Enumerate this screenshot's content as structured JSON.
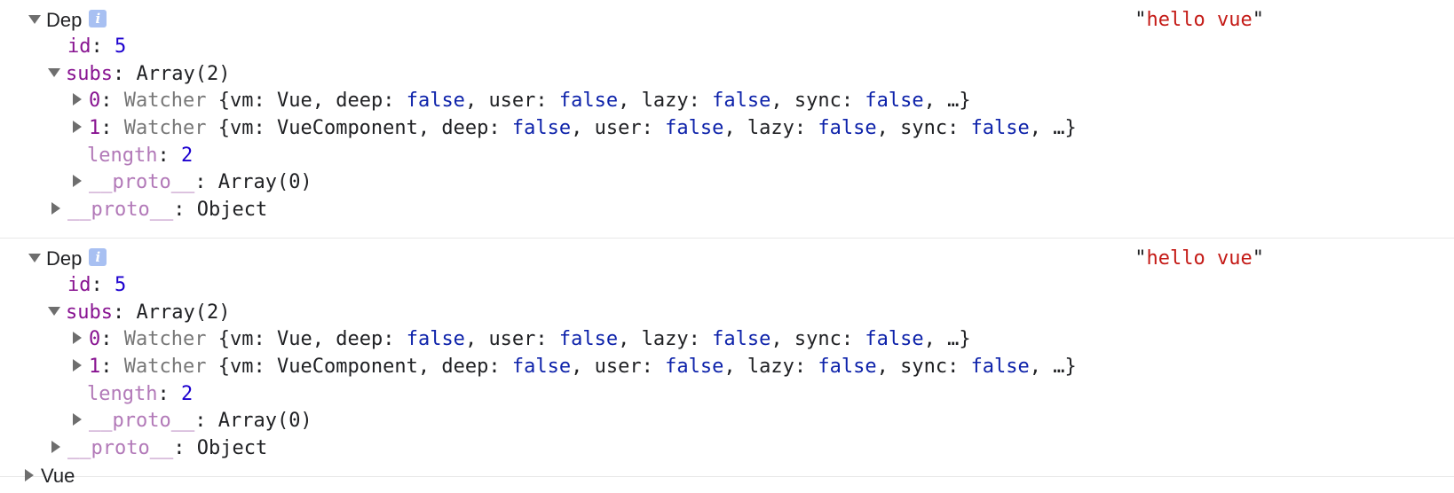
{
  "entries": [
    {
      "title": "Dep",
      "info_icon": "i",
      "message": "hello vue",
      "id_key": "id",
      "id_value": "5",
      "subs_key": "subs",
      "subs_value": "Array(2)",
      "items": [
        {
          "index": "0",
          "class": "Watcher",
          "preview": [
            {
              "k": "vm",
              "v": "Vue",
              "t": "plain"
            },
            {
              "k": "deep",
              "v": "false",
              "t": "kw"
            },
            {
              "k": "user",
              "v": "false",
              "t": "kw"
            },
            {
              "k": "lazy",
              "v": "false",
              "t": "kw"
            },
            {
              "k": "sync",
              "v": "false",
              "t": "kw"
            }
          ]
        },
        {
          "index": "1",
          "class": "Watcher",
          "preview": [
            {
              "k": "vm",
              "v": "VueComponent",
              "t": "plain"
            },
            {
              "k": "deep",
              "v": "false",
              "t": "kw"
            },
            {
              "k": "user",
              "v": "false",
              "t": "kw"
            },
            {
              "k": "lazy",
              "v": "false",
              "t": "kw"
            },
            {
              "k": "sync",
              "v": "false",
              "t": "kw"
            }
          ]
        }
      ],
      "length_key": "length",
      "length_value": "2",
      "array_proto_key": "__proto__",
      "array_proto_value": "Array(0)",
      "proto_key": "__proto__",
      "proto_value": "Object"
    },
    {
      "title": "Dep",
      "info_icon": "i",
      "message": "hello vue",
      "id_key": "id",
      "id_value": "5",
      "subs_key": "subs",
      "subs_value": "Array(2)",
      "items": [
        {
          "index": "0",
          "class": "Watcher",
          "preview": [
            {
              "k": "vm",
              "v": "Vue",
              "t": "plain"
            },
            {
              "k": "deep",
              "v": "false",
              "t": "kw"
            },
            {
              "k": "user",
              "v": "false",
              "t": "kw"
            },
            {
              "k": "lazy",
              "v": "false",
              "t": "kw"
            },
            {
              "k": "sync",
              "v": "false",
              "t": "kw"
            }
          ]
        },
        {
          "index": "1",
          "class": "Watcher",
          "preview": [
            {
              "k": "vm",
              "v": "VueComponent",
              "t": "plain"
            },
            {
              "k": "deep",
              "v": "false",
              "t": "kw"
            },
            {
              "k": "user",
              "v": "false",
              "t": "kw"
            },
            {
              "k": "lazy",
              "v": "false",
              "t": "kw"
            },
            {
              "k": "sync",
              "v": "false",
              "t": "kw"
            }
          ]
        }
      ],
      "length_key": "length",
      "length_value": "2",
      "array_proto_key": "__proto__",
      "array_proto_value": "Array(0)",
      "proto_key": "__proto__",
      "proto_value": "Object"
    }
  ],
  "partial_entry": {
    "title": "Vue"
  },
  "colors": {
    "key": "#881391",
    "key_dim": "#b279b8",
    "number": "#1c00cf",
    "boolean": "#0d22aa",
    "class_name": "#777777",
    "string": "#c41a16",
    "info_icon_bg": "#a8c0f2",
    "divider": "#e8e8e8"
  }
}
